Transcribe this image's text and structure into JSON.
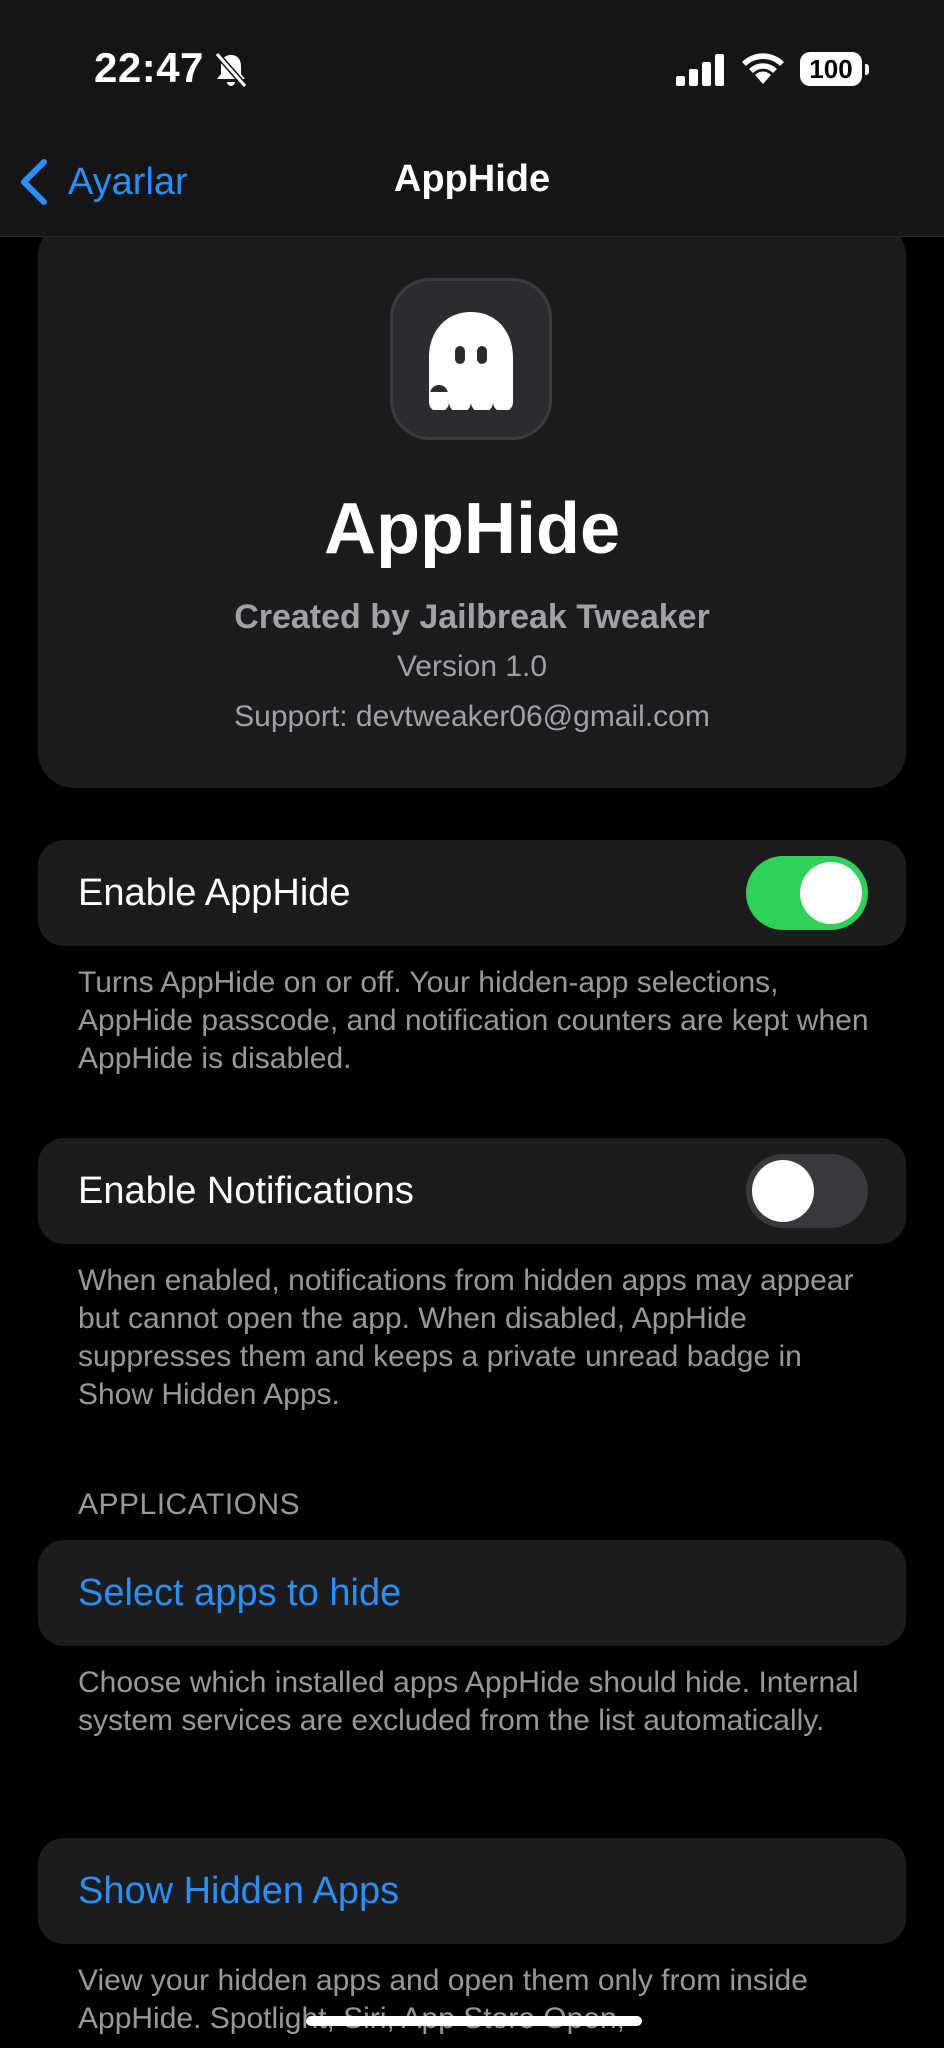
{
  "status_bar": {
    "time": "22:47",
    "battery": "100"
  },
  "nav": {
    "back_label": "Ayarlar",
    "title": "AppHide"
  },
  "header": {
    "app_name": "AppHide",
    "creator": "Created by Jailbreak Tweaker",
    "version": "Version 1.0",
    "support": "Support: devtweaker06@gmail.com"
  },
  "settings": {
    "enable_apphide": {
      "label": "Enable AppHide",
      "enabled": true,
      "footer": "Turns AppHide on or off. Your hidden-app selections, AppHide passcode, and notification counters are kept when AppHide is disabled."
    },
    "enable_notifications": {
      "label": "Enable Notifications",
      "enabled": false,
      "footer": "When enabled, notifications from hidden apps may appear but cannot open the app. When disabled, AppHide suppresses them and keeps a private unread badge in Show Hidden Apps."
    },
    "applications_header": "APPLICATIONS",
    "select_apps": {
      "label": "Select apps to hide",
      "footer": "Choose which installed apps AppHide should hide. Internal system services are excluded from the list automatically."
    },
    "show_hidden": {
      "label": "Show Hidden Apps",
      "footer": "View your hidden apps and open them only from inside AppHide. Spotlight, Siri, App Store Open,"
    }
  },
  "colors": {
    "accent": "#2a8ff7",
    "toggle_on": "#30d158",
    "card": "#1c1c1e",
    "secondary_text": "#98989d"
  }
}
